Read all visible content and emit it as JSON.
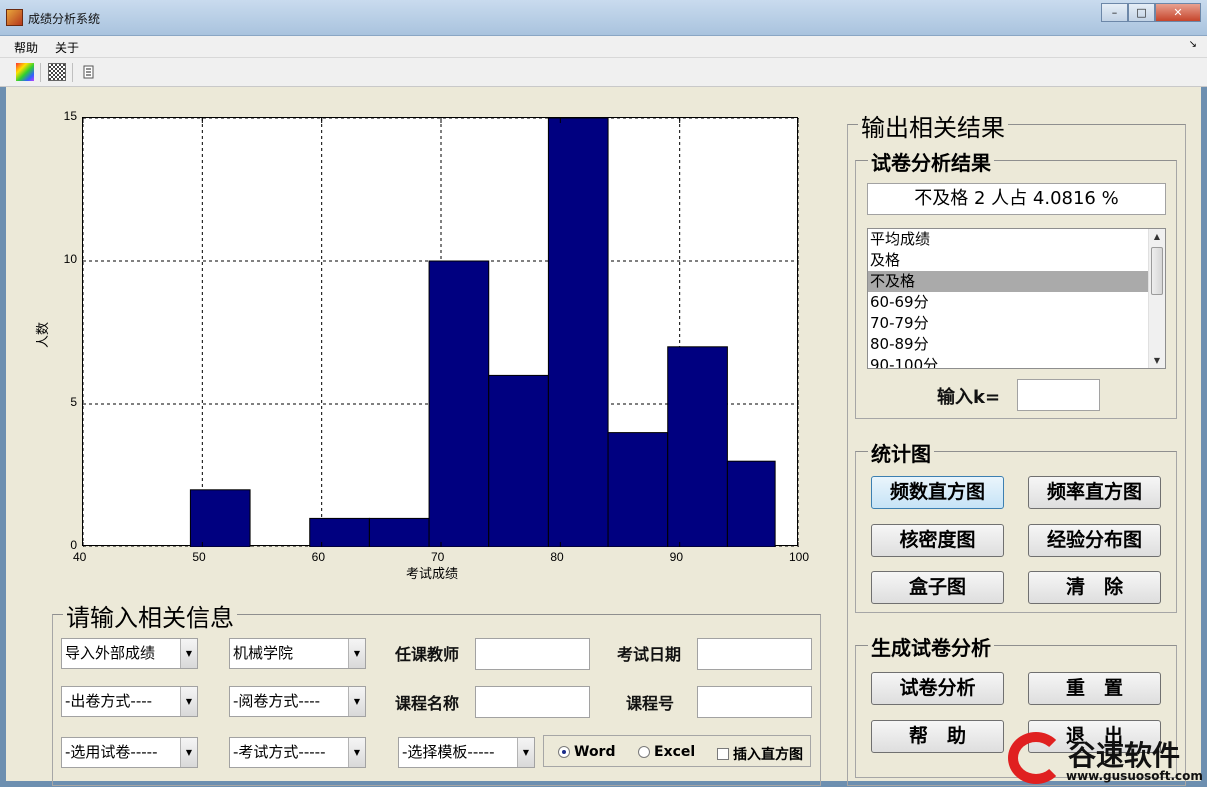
{
  "window": {
    "title": "成绩分析系统",
    "minimize": "–",
    "maximize": "□",
    "close": "✕"
  },
  "menu": {
    "items": [
      "帮助",
      "关于"
    ],
    "dock": "↘"
  },
  "chart_data": {
    "type": "bar",
    "bins": [
      {
        "x0": 49,
        "x1": 54,
        "count": 2
      },
      {
        "x0": 54,
        "x1": 59,
        "count": 0
      },
      {
        "x0": 59,
        "x1": 64,
        "count": 1
      },
      {
        "x0": 64,
        "x1": 69,
        "count": 1
      },
      {
        "x0": 69,
        "x1": 74,
        "count": 10
      },
      {
        "x0": 74,
        "x1": 79,
        "count": 6
      },
      {
        "x0": 79,
        "x1": 84,
        "count": 15
      },
      {
        "x0": 84,
        "x1": 89,
        "count": 4
      },
      {
        "x0": 89,
        "x1": 94,
        "count": 7
      },
      {
        "x0": 94,
        "x1": 98,
        "count": 3
      }
    ],
    "xlim": [
      40,
      100
    ],
    "ylim": [
      0,
      15
    ],
    "xticks": [
      40,
      50,
      60,
      70,
      80,
      90,
      100
    ],
    "yticks": [
      0,
      5,
      10,
      15
    ],
    "xlabel": "考试成绩",
    "ylabel": "人数",
    "grid": true,
    "bar_color": "#000080"
  },
  "input_panel": {
    "title": "请输入相关信息",
    "import_combo": "导入外部成绩",
    "college_combo": "机械学院",
    "teacher_label": "任课教师",
    "teacher_value": "",
    "date_label": "考试日期",
    "date_value": "",
    "paper_method_combo": "-出卷方式----",
    "grading_method_combo": "-阅卷方式----",
    "course_name_label": "课程名称",
    "course_name_value": "",
    "course_no_label": "课程号",
    "course_no_value": "",
    "paper_select_combo": "-选用试卷-----",
    "exam_method_combo": "-考试方式-----",
    "template_combo": "-选择模板-----",
    "radio_word": "Word",
    "radio_excel": "Excel",
    "check_histogram": "插入直方图",
    "selected_radio": "Word"
  },
  "output_panel": {
    "title": "输出相关结果",
    "analysis_group_title": "试卷分析结果",
    "result_text": "不及格 2 人占 4.0816 %",
    "list_items": [
      "平均成绩",
      "及格",
      "不及格",
      "60-69分",
      "70-79分",
      "80-89分",
      "90-100分"
    ],
    "selected_index": 2,
    "k_label": "输入k=",
    "k_value": ""
  },
  "stats_panel": {
    "title": "统计图",
    "freq_count_hist": "频数直方图",
    "freq_rate_hist": "频率直方图",
    "kde_plot": "核密度图",
    "empirical_dist": "经验分布图",
    "box_plot": "盒子图",
    "clear": "清　除"
  },
  "generate_panel": {
    "title": "生成试卷分析",
    "analyze": "试卷分析",
    "reset": "重　置",
    "help": "帮　助",
    "exit": "退　出"
  },
  "watermark": {
    "brand": "谷速软件",
    "url": "www.gusuosoft.com"
  }
}
